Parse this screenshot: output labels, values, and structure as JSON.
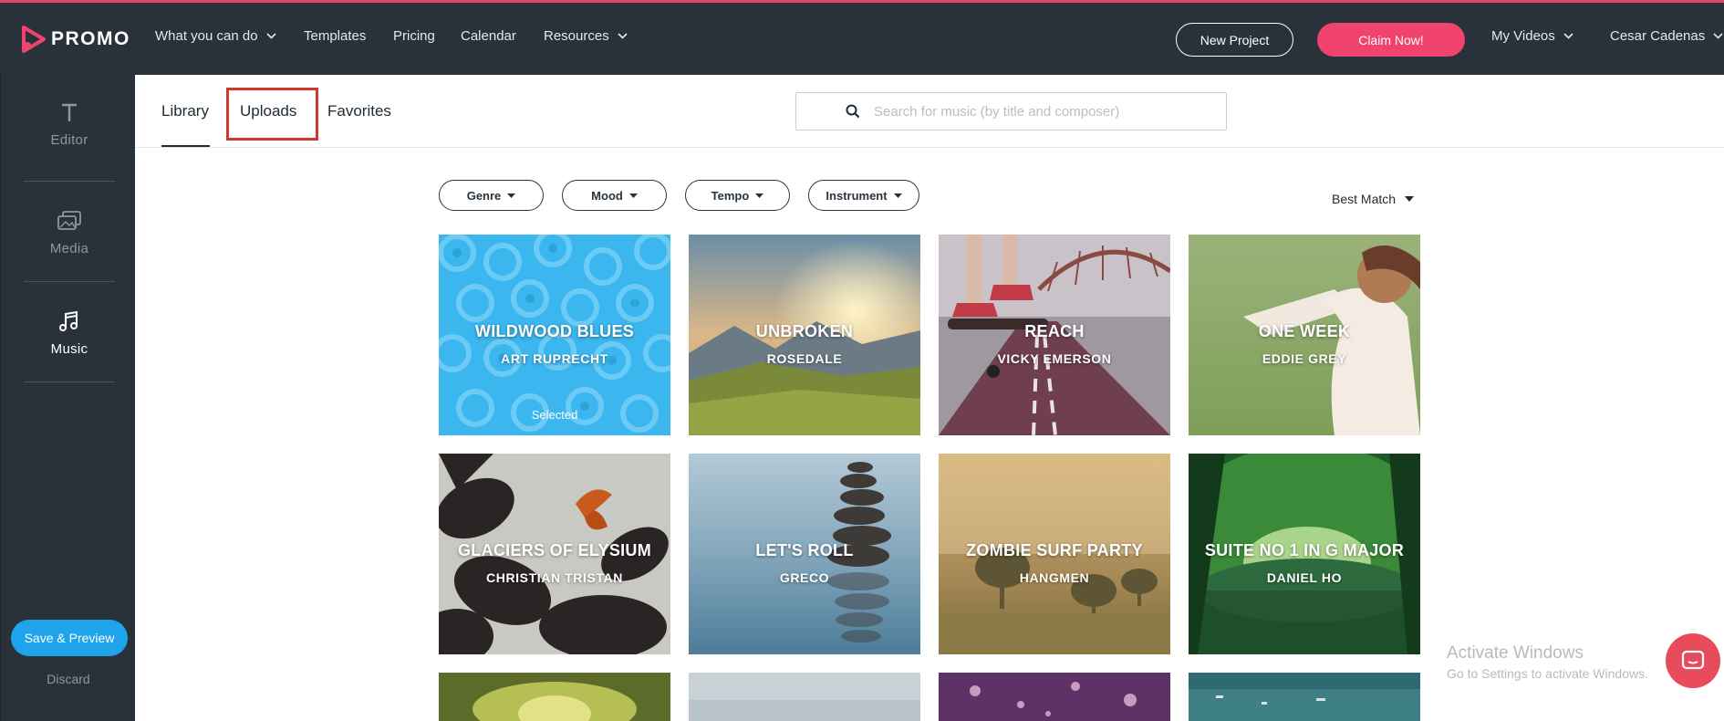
{
  "brand": {
    "name": "PROMO",
    "accent": "#f0436d"
  },
  "nav": {
    "items": [
      "What you can do",
      "Templates",
      "Pricing",
      "Calendar",
      "Resources"
    ],
    "new_project": "New Project",
    "claim": "Claim Now!",
    "my_videos": "My Videos",
    "user": "Cesar Cadenas"
  },
  "sidebar": {
    "items": [
      {
        "label": "Editor",
        "icon": "text-icon"
      },
      {
        "label": "Media",
        "icon": "media-icon"
      },
      {
        "label": "Music",
        "icon": "music-icon",
        "active": true
      }
    ],
    "save_label": "Save & Preview",
    "discard_label": "Discard"
  },
  "tabs": [
    "Library",
    "Uploads",
    "Favorites"
  ],
  "active_tab": "Library",
  "highlighted_tab": "Uploads",
  "search": {
    "placeholder": "Search for music (by title and composer)"
  },
  "filters": [
    "Genre",
    "Mood",
    "Tempo",
    "Instrument"
  ],
  "sort": "Best Match",
  "tracks": [
    {
      "title": "WILDWOOD BLUES",
      "artist": "ART RUPRECHT",
      "status": "Selected"
    },
    {
      "title": "UNBROKEN",
      "artist": "ROSEDALE"
    },
    {
      "title": "REACH",
      "artist": "VICKY EMERSON"
    },
    {
      "title": "ONE WEEK",
      "artist": "EDDIE GREY"
    },
    {
      "title": "GLACIERS OF ELYSIUM",
      "artist": "CHRISTIAN TRISTAN"
    },
    {
      "title": "LET'S ROLL",
      "artist": "GRECO"
    },
    {
      "title": "ZOMBIE SURF PARTY",
      "artist": "HANGMEN"
    },
    {
      "title": "SUITE NO 1 IN G MAJOR",
      "artist": "DANIEL HO"
    }
  ],
  "os_watermark": {
    "line1": "Activate Windows",
    "line2": "Go to Settings to activate Windows."
  }
}
